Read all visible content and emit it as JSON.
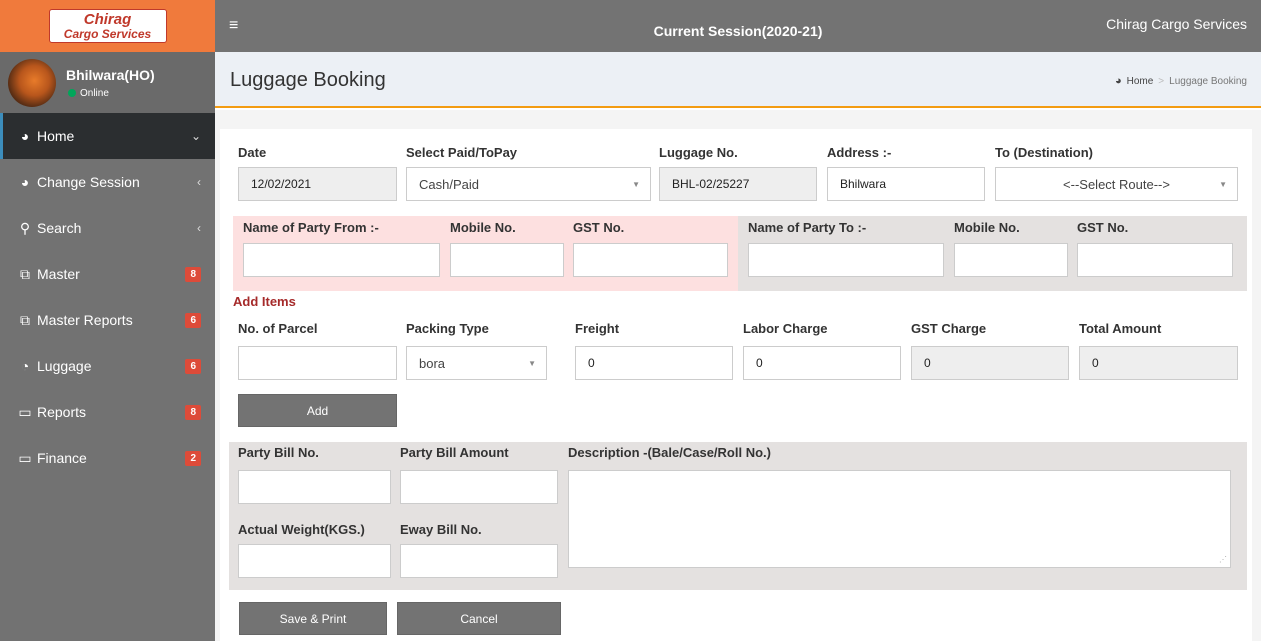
{
  "brand": {
    "logo_top": "Chirag",
    "logo_bottom": "Cargo Services"
  },
  "user": {
    "name": "Bhilwara(HO)",
    "status": "Online"
  },
  "sidebar": {
    "items": [
      {
        "label": "Home",
        "icon": "dashboard-icon",
        "arrow": "⌄"
      },
      {
        "label": "Change Session",
        "icon": "dashboard-icon",
        "arrow": "‹"
      },
      {
        "label": "Search",
        "icon": "search-icon",
        "arrow": "‹"
      },
      {
        "label": "Master",
        "icon": "copy-icon",
        "badge": "8"
      },
      {
        "label": "Master Reports",
        "icon": "copy-icon",
        "badge": "6"
      },
      {
        "label": "Luggage",
        "icon": "pie-chart-icon",
        "badge": "6"
      },
      {
        "label": "Reports",
        "icon": "laptop-icon",
        "badge": "8"
      },
      {
        "label": "Finance",
        "icon": "laptop-icon",
        "badge": "2"
      }
    ]
  },
  "header": {
    "menu_icon": "≡",
    "session": "Current Session(2020-21)",
    "company": "Chirag Cargo Services"
  },
  "page": {
    "title": "Luggage Booking",
    "breadcrumb_home": "Home",
    "breadcrumb_sep": ">",
    "breadcrumb_current": "Luggage Booking"
  },
  "form": {
    "date_label": "Date",
    "date_value": "12/02/2021",
    "paid_label": "Select Paid/ToPay",
    "paid_value": "Cash/Paid",
    "luggage_no_label": "Luggage No.",
    "luggage_no_value": "BHL-02/25227",
    "address_label": "Address :-",
    "address_value": "Bhilwara",
    "destination_label": "To (Destination)",
    "destination_value": "<--Select Route-->",
    "party_from_label": "Name of Party From :-",
    "mobile_from_label": "Mobile No.",
    "gst_from_label": "GST No.",
    "party_to_label": "Name of Party To :-",
    "mobile_to_label": "Mobile No.",
    "gst_to_label": "GST No.",
    "add_items_title": "Add Items",
    "parcel_label": "No. of Parcel",
    "packing_label": "Packing Type",
    "packing_value": "bora",
    "freight_label": "Freight",
    "freight_value": "0",
    "labor_label": "Labor Charge",
    "labor_value": "0",
    "gst_charge_label": "GST Charge",
    "gst_charge_value": "0",
    "total_label": "Total Amount",
    "total_value": "0",
    "add_button": "Add",
    "party_bill_no_label": "Party Bill No.",
    "party_bill_amount_label": "Party Bill Amount",
    "description_label": "Description -(Bale/Case/Roll No.)",
    "actual_weight_label": "Actual Weight(KGS.)",
    "eway_label": "Eway Bill No.",
    "save_button": "Save & Print",
    "cancel_button": "Cancel"
  },
  "colors": {
    "logo_bg": "#f07a3c",
    "sidebar_bg": "#727272",
    "active_bg": "#2b2e30",
    "badge": "#dd4b39",
    "accent": "#f39c12",
    "party_from_bg": "#fde0e0",
    "party_to_bg": "#e4e1e0",
    "section_title": "#a52a2a"
  }
}
